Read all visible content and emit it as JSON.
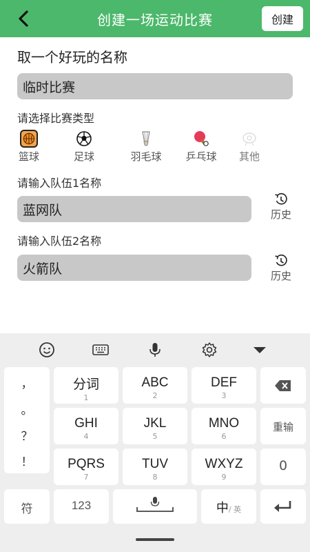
{
  "header": {
    "title": "创建一场运动比赛",
    "create_label": "创建"
  },
  "form": {
    "heading": "取一个好玩的名称",
    "match_name_value": "临时比赛",
    "type_label": "请选择比赛类型",
    "types": [
      {
        "label": "篮球",
        "icon": "basketball-icon",
        "selected": true
      },
      {
        "label": "足球",
        "icon": "soccer-ball-icon",
        "selected": false
      },
      {
        "label": "羽毛球",
        "icon": "shuttlecock-icon",
        "selected": false
      },
      {
        "label": "乒乓球",
        "icon": "ping-pong-icon",
        "selected": false
      },
      {
        "label": "其他",
        "icon": "other-sport-icon",
        "selected": false
      }
    ],
    "team1_label": "请输入队伍1名称",
    "team1_value": "蓝网队",
    "team2_label": "请输入队伍2名称",
    "team2_value": "火箭队",
    "history_label": "历史"
  },
  "keyboard": {
    "punctuation": [
      "，",
      "。",
      "？",
      "！"
    ],
    "rows": [
      [
        {
          "main": "分词",
          "sub": "1"
        },
        {
          "main": "ABC",
          "sub": "2"
        },
        {
          "main": "DEF",
          "sub": "3"
        }
      ],
      [
        {
          "main": "GHI",
          "sub": "4"
        },
        {
          "main": "JKL",
          "sub": "5"
        },
        {
          "main": "MNO",
          "sub": "6"
        }
      ],
      [
        {
          "main": "PQRS",
          "sub": "7"
        },
        {
          "main": "TUV",
          "sub": "8"
        },
        {
          "main": "WXYZ",
          "sub": "9"
        }
      ]
    ],
    "reinput_label": "重输",
    "zero_label": "0",
    "symbol_label": "符",
    "num_label": "123",
    "zh_label": "中",
    "en_label": "/ 英"
  },
  "colors": {
    "accent": "#4cb86b",
    "input_bg": "#c8c8c8",
    "keyboard_bg": "#eeeeee"
  }
}
